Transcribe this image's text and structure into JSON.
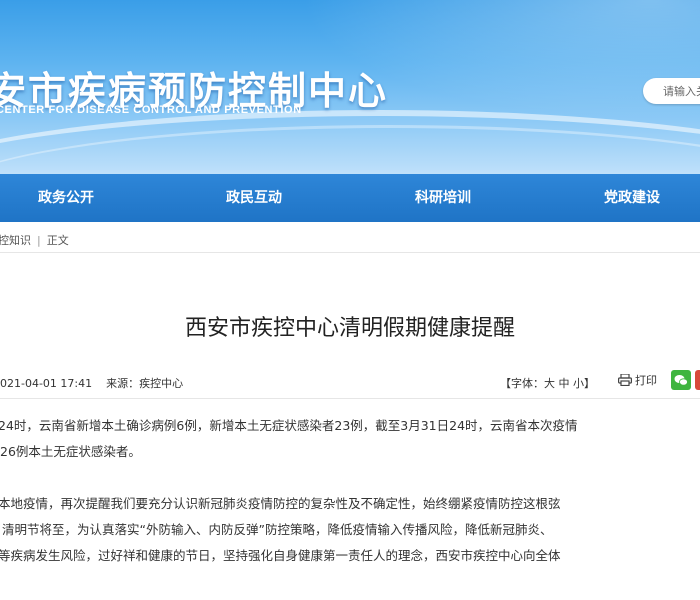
{
  "header": {
    "site_title": "安市疾病预防控制中心",
    "site_subtitle": "CENTER FOR DISEASE CONTROL AND PREVENTION",
    "search_placeholder": "请输入关键"
  },
  "nav": {
    "items": [
      {
        "label": "政务公开"
      },
      {
        "label": "政民互动"
      },
      {
        "label": "科研培训"
      },
      {
        "label": "党政建设"
      }
    ]
  },
  "breadcrumb": {
    "parent": "控知识",
    "current": "正文"
  },
  "article": {
    "title": "西安市疾控中心清明假期健康提醒",
    "date": "021-04-01 17:41",
    "source": "来源：疾控中心",
    "font_label": "【字体：",
    "font_large": "大",
    "font_medium": "中",
    "font_small": "小",
    "font_close": "】",
    "print_label": "打印",
    "paragraphs": [
      "24时，云南省新增本土确诊病例6例，新增本土无症状感染者23例，截至3月31日24时，云南省本次疫情",
      "26例本土无症状感染者。",
      "本地疫情，再次提醒我们要充分认识新冠肺炎疫情防控的复杂性及不确定性，始终绷紧疫情防控这根弦",
      "清明节将至，为认真落实“外防输入、内防反弹”防控策略，降低疫情输入传播风险，降低新冠肺炎、",
      "等疾病发生风险，过好祥和健康的节日，坚持强化自身健康第一责任人的理念，西安市疾控中心向全体"
    ]
  },
  "colors": {
    "banner": "#4aa8ec",
    "navbar": "#2479ca",
    "wechat": "#3fb53f"
  }
}
